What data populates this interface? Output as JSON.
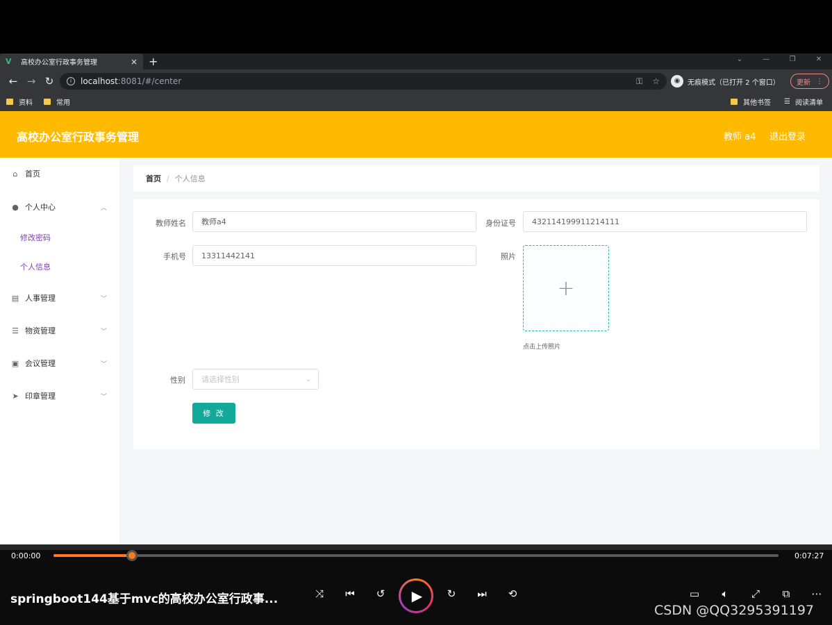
{
  "browser": {
    "tab_title": "高校办公室行政事务管理",
    "tab_close": "×",
    "new_tab": "+",
    "url_host": "localhost",
    "url_path": ":8081/#/center",
    "incognito_label": "无痕模式（已打开 2 个窗口）",
    "update_label": "更新",
    "bookmarks": [
      "资料",
      "常用"
    ],
    "bookmarks_right": [
      "其他书签",
      "阅读清单"
    ]
  },
  "header": {
    "title": "高校办公室行政事务管理",
    "user": "教师 a4",
    "logout": "退出登录"
  },
  "sidebar": {
    "items": [
      {
        "label": "首页",
        "icon": "home-icon"
      },
      {
        "label": "个人中心",
        "icon": "user-icon"
      },
      {
        "label": "人事管理",
        "icon": "clipboard-icon"
      },
      {
        "label": "物资管理",
        "icon": "list-icon"
      },
      {
        "label": "会议管理",
        "icon": "calendar-icon"
      },
      {
        "label": "印章管理",
        "icon": "send-icon"
      }
    ],
    "subitems": [
      "修改密码",
      "个人信息"
    ]
  },
  "breadcrumb": {
    "home": "首页",
    "separator": "/",
    "current": "个人信息"
  },
  "form": {
    "name_label": "教师姓名",
    "name_value": "教师a4",
    "id_label": "身份证号",
    "id_value": "432114199911214111",
    "phone_label": "手机号",
    "phone_value": "13311442141",
    "photo_label": "照片",
    "photo_plus": "+",
    "photo_hint": "点击上传照片",
    "gender_label": "性别",
    "gender_placeholder": "请选择性别",
    "submit_label": "修 改"
  },
  "player": {
    "time_current": "0:00:00",
    "time_total": "0:07:27",
    "progress_fraction": 0.108,
    "video_title": "springboot144基于mvc的高校办公室行政事...",
    "watermark": "CSDN @QQ3295391197"
  },
  "colors": {
    "header_bg": "#ffba00",
    "primary_button": "#12a89a",
    "progress": "#ff7a1a",
    "submenu_text": "#7b3fb0"
  }
}
